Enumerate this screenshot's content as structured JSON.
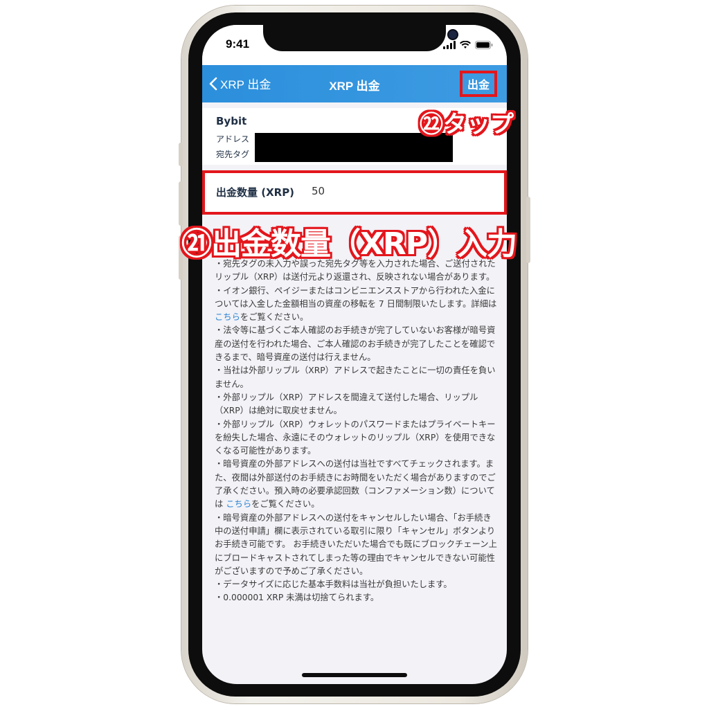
{
  "status_bar": {
    "time": "9:41"
  },
  "nav": {
    "back_label": "XRP 出金",
    "title": "XRP 出金",
    "action_label": "出金"
  },
  "destination": {
    "name": "Bybit",
    "address_label": "アドレス",
    "tag_label": "宛先タグ"
  },
  "amount": {
    "label": "出金数量 (XRP)",
    "value": "50"
  },
  "notes": [
    {
      "text": "・宛先タグの未入力や誤った宛先タグ等を入力された場合、ご送付されたリップル（XRP）は送付元より返還され、反映されない場合があります。"
    },
    {
      "text": "・イオン銀行、ペイジーまたはコンビニエンスストアから行われた入金については入金した金額相当の資産の移転を 7 日間制限いたします。詳細は ",
      "link": "こちら",
      "after": "をご覧ください。"
    },
    {
      "text": "・法令等に基づくご本人確認のお手続きが完了していないお客様が暗号資産の送付を行われた場合、ご本人確認のお手続きが完了したことを確認できるまで、暗号資産の送付は行えません。"
    },
    {
      "text": "・当社は外部リップル（XRP）アドレスで起きたことに一切の責任を負いません。"
    },
    {
      "text": "・外部リップル（XRP）アドレスを間違えて送付した場合、リップル（XRP）は絶対に取戻せません。"
    },
    {
      "text": "・外部リップル（XRP）ウォレットのパスワードまたはプライベートキーを紛失した場合、永遠にそのウォレットのリップル（XRP）を使用できなくなる可能性があります。"
    },
    {
      "text": "・暗号資産の外部アドレスへの送付は当社ですべてチェックされます。また、夜間は外部送付のお手続きにお時間をいただく場合がありますのでご了承ください。預入時の必要承認回数（コンファメーション数）については ",
      "link": "こちら",
      "after": "をご覧ください。"
    },
    {
      "text": "・暗号資産の外部アドレスへの送付をキャンセルしたい場合、「お手続き中の送付申請」欄に表示されている取引に限り「キャンセル」ボタンよりお手続き可能です。 お手続きいただいた場合でも既にブロックチェーン上にブロードキャストされてしまった等の理由でキャンセルできない可能性がございますので予めご了承ください。"
    },
    {
      "text": "・データサイズに応じた基本手数料は当社が負担いたします。"
    },
    {
      "text": "・0.000001 XRP 未満は切捨てられます。"
    }
  ],
  "annotations": {
    "tap_label": "㉒タップ",
    "amount_label": "㉑出金数量（XRP）入力"
  },
  "colors": {
    "nav": "#2c8fdc",
    "annotation": "#e3161c",
    "link": "#2c84d2"
  }
}
